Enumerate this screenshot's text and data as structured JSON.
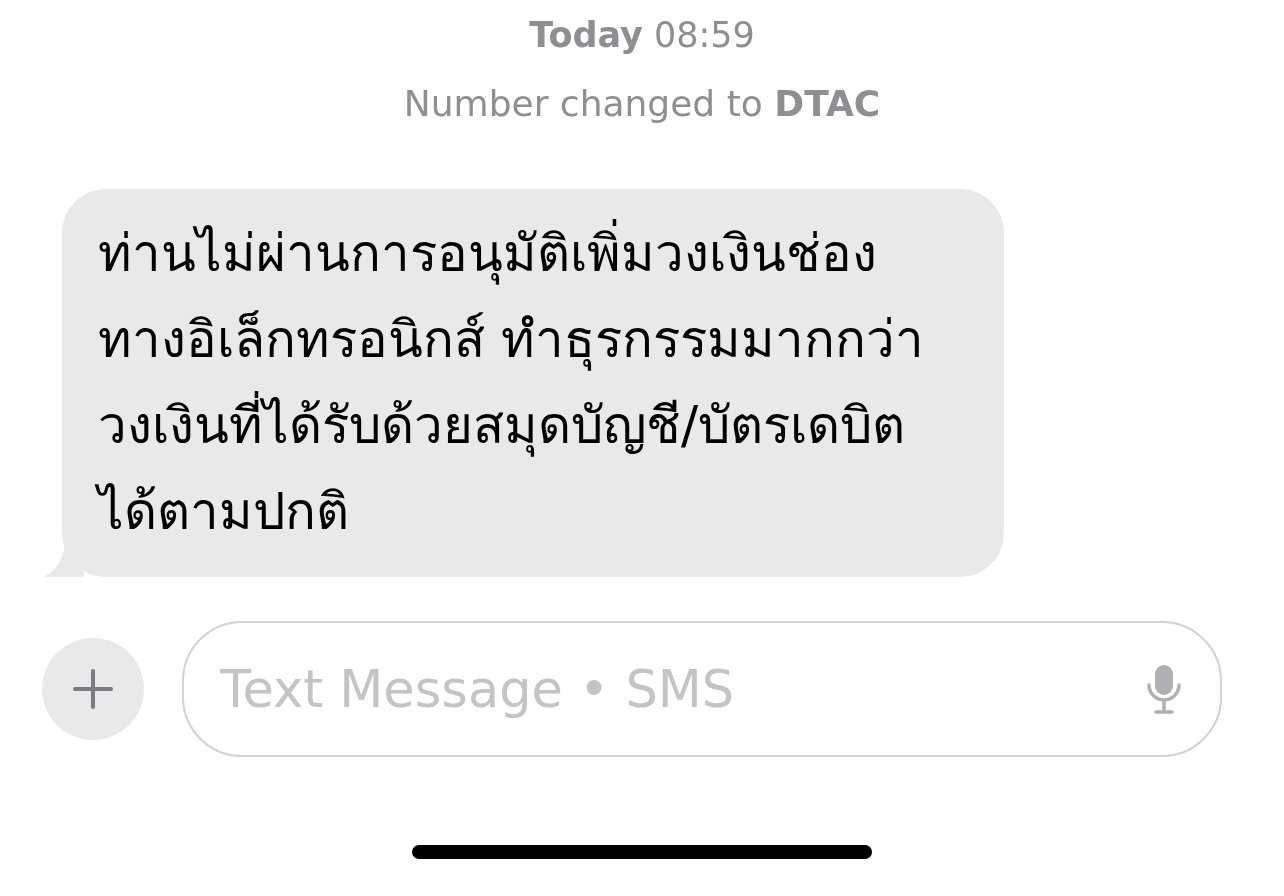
{
  "timestamp": "**Today** 08:59",
  "notice": "Number changed to **DTAC**",
  "messages": [
    {
      "kind": "incoming",
      "text": "ท่านไม่ผ่านการอนุมัติเพิ่มวงเงินช่อง\nทางอิเล็กทรอนิกส์ ทำธุรกรรมมากกว่า\nวงเงินที่ได้รับด้วยสมุดบัญชี/บัตรเดบิต\nได้ตามปกติ"
    }
  ],
  "composer": {
    "placeholder": "Text Message • SMS"
  }
}
